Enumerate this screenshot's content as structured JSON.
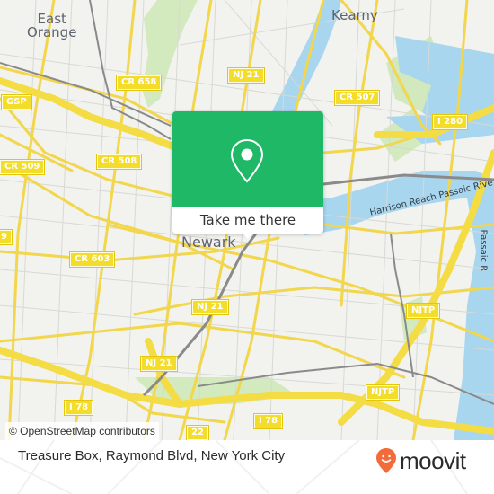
{
  "map": {
    "places": [
      {
        "id": "east-orange",
        "label": "East\nOrange"
      },
      {
        "id": "kearny",
        "label": "Kearny"
      },
      {
        "id": "newark",
        "label": "Newark"
      }
    ],
    "shields": [
      {
        "id": "cr-658",
        "label": "CR 658"
      },
      {
        "id": "nj-21-north",
        "label": "NJ 21"
      },
      {
        "id": "cr-507",
        "label": "CR 507"
      },
      {
        "id": "gsp",
        "label": "GSP"
      },
      {
        "id": "i-280",
        "label": "I 280"
      },
      {
        "id": "cr-509",
        "label": "CR 509"
      },
      {
        "id": "cr-508",
        "label": "CR 508"
      },
      {
        "id": "cr-509-partial",
        "label": "9"
      },
      {
        "id": "cr-603",
        "label": "CR 603"
      },
      {
        "id": "nj-21-mid",
        "label": "NJ 21"
      },
      {
        "id": "njtp-north",
        "label": "NJTP"
      },
      {
        "id": "nj-21-south",
        "label": "NJ 21"
      },
      {
        "id": "njtp-south",
        "label": "NJTP"
      },
      {
        "id": "i-78-west",
        "label": "I 78"
      },
      {
        "id": "i-78-east",
        "label": "I 78"
      },
      {
        "id": "route-22-partial",
        "label": "22"
      }
    ],
    "water_labels": [
      {
        "id": "harrison-reach",
        "label": "Harrison Reach Passaic Rive"
      },
      {
        "id": "passaic-partial",
        "label": "Passaic R"
      }
    ],
    "attribution": "© OpenStreetMap contributors"
  },
  "popup": {
    "icon": "location-pin-icon",
    "cta_label": "Take me there",
    "color": "#1fb866"
  },
  "footer": {
    "title": "Treasure Box, Raymond Blvd, New York City",
    "brand": "moovit",
    "brand_icon": "moovit-smiley-pin-icon",
    "brand_color": "#f26b3a"
  }
}
